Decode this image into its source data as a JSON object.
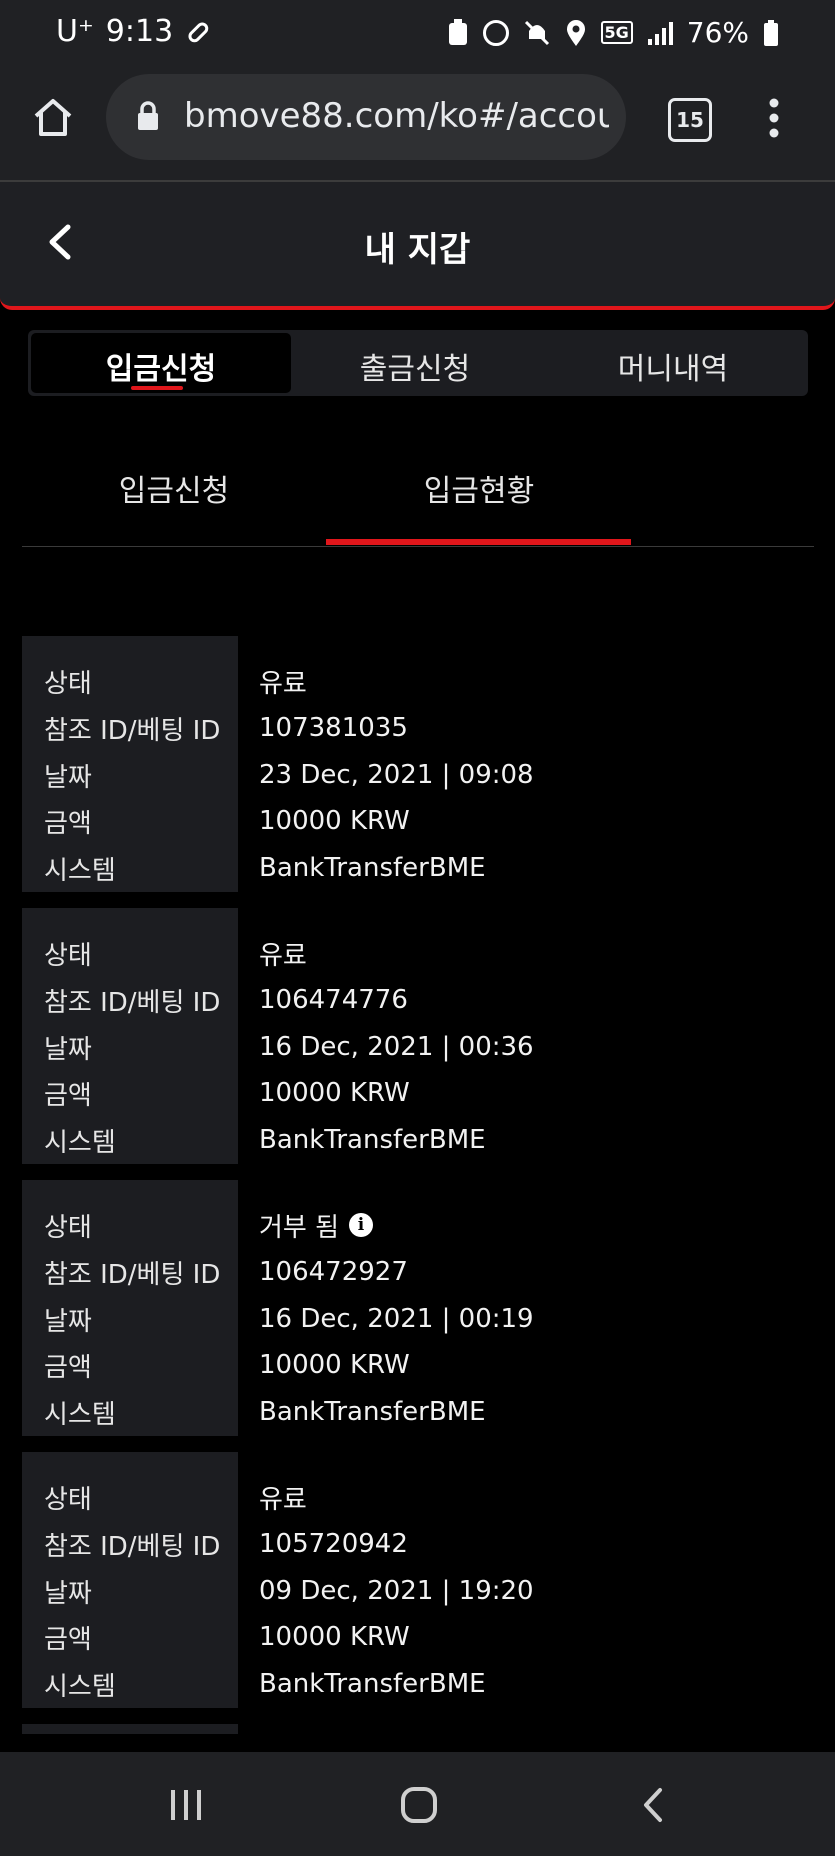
{
  "status_bar": {
    "carrier": "U⁺",
    "time": "9:13",
    "network": "5G",
    "battery": "76%"
  },
  "browser": {
    "url": "bmove88.com/ko#/accoun",
    "tab_count": "15"
  },
  "header": {
    "title": "내 지갑"
  },
  "segments": [
    {
      "label": "입금신청",
      "active": true
    },
    {
      "label": "출금신청",
      "active": false
    },
    {
      "label": "머니내역",
      "active": false
    }
  ],
  "sub_tabs": [
    {
      "label": "입금신청",
      "active": false
    },
    {
      "label": "입금현황",
      "active": true
    }
  ],
  "field_labels": {
    "status": "상태",
    "ref_id": "참조 ID/베팅 ID",
    "date": "날짜",
    "amount": "금액",
    "system": "시스템"
  },
  "records": [
    {
      "status": "유료",
      "ref_id": "107381035",
      "date": "23 Dec, 2021 | 09:08",
      "amount": "10000 KRW",
      "system": "BankTransferBME",
      "info": false
    },
    {
      "status": "유료",
      "ref_id": "106474776",
      "date": "16 Dec, 2021 | 00:36",
      "amount": "10000 KRW",
      "system": "BankTransferBME",
      "info": false
    },
    {
      "status": "거부 됨",
      "ref_id": "106472927",
      "date": "16 Dec, 2021 | 00:19",
      "amount": "10000 KRW",
      "system": "BankTransferBME",
      "info": true
    },
    {
      "status": "유료",
      "ref_id": "105720942",
      "date": "09 Dec, 2021 | 19:20",
      "amount": "10000 KRW",
      "system": "BankTransferBME",
      "info": false
    }
  ],
  "colors": {
    "accent": "#e0161b",
    "panel": "#1c1d21",
    "background": "#000000"
  }
}
